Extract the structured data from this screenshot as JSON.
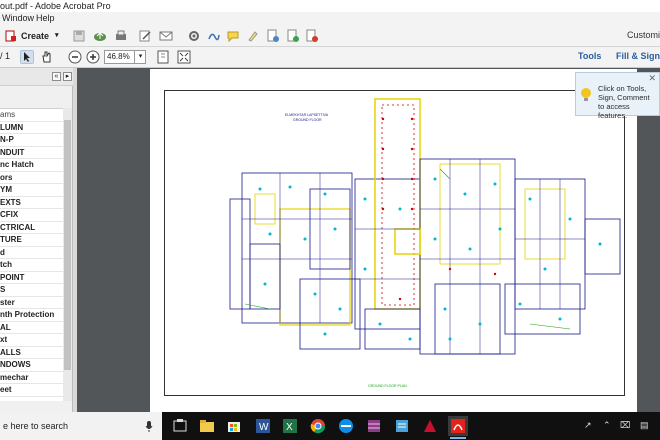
{
  "window": {
    "title": "out.pdf - Adobe Acrobat Pro"
  },
  "menu": {
    "items": [
      "Window",
      "Help"
    ]
  },
  "toolbar": {
    "create_label": "Create",
    "customize_label": "Customi",
    "tools_label": "Tools",
    "fill_sign_label": "Fill & Sign"
  },
  "nav": {
    "page_text": "/ 1",
    "zoom_value": "46.8%"
  },
  "sidebar": {
    "layers": [
      "ams",
      "LUMN",
      "N-P",
      "NDUIT",
      "nc Hatch",
      "ors",
      "YM",
      "EXTS",
      "CFIX",
      "CTRICAL",
      "TURE",
      "d",
      "tch",
      "POINT",
      "S",
      "ster",
      "nth Protection",
      "AL",
      "xt",
      "ALLS",
      "NDOWS",
      "mechar",
      "eet"
    ]
  },
  "tooltip": {
    "text": "Click on Tools, Sign, Comment to access features."
  },
  "drawing": {
    "title_line1": "ELMEKHTAR LAPSETTIVA",
    "title_line2": "GROUND FLOOR",
    "footer_label": "GROUND FLOOR PLAN"
  },
  "taskbar": {
    "search_placeholder": "e here to search",
    "apps": [
      "task-view",
      "file-explorer",
      "store",
      "word",
      "excel",
      "chrome",
      "teamviewer",
      "winrar",
      "notepad",
      "autocad",
      "acrobat"
    ],
    "tray_symbols": [
      "↗",
      "⌃",
      "⌧",
      "▤"
    ]
  },
  "colors": {
    "accent": "#2b5f9e",
    "doc_bg": "#525659",
    "plan_line": "#1a1a8a",
    "plan_yellow": "#e6d400",
    "plan_cyan": "#00b8d4",
    "plan_red": "#d00000",
    "plan_green": "#1aa01a"
  }
}
